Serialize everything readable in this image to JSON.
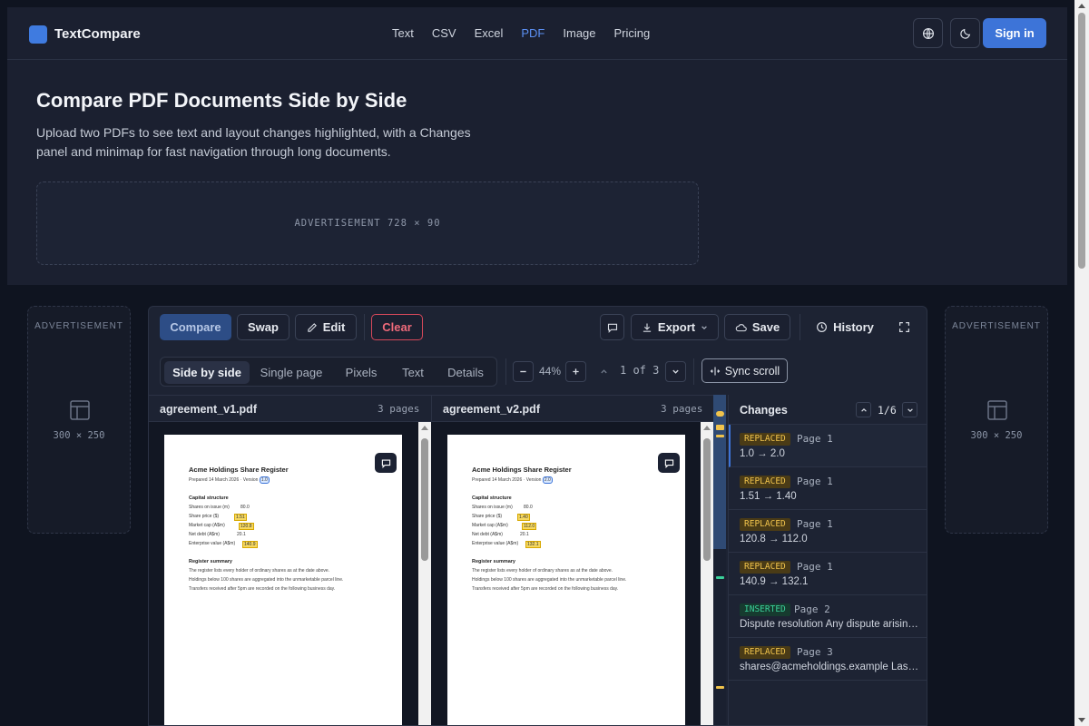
{
  "navbar": {
    "brand": "TextCompare",
    "links": [
      "Text",
      "CSV",
      "Excel",
      "PDF",
      "Image",
      "Pricing"
    ],
    "active_link": "PDF",
    "signin_label": "Sign in"
  },
  "hero": {
    "title": "Compare PDF Documents Side by Side",
    "subtitle": "Upload two PDFs to see text and layout changes highlighted, with a Changes panel and minimap for fast navigation through long documents."
  },
  "ads": {
    "top_label": "ADVERTISEMENT  728 × 90",
    "side_label": "ADVERTISEMENT",
    "side_size": "300 × 250"
  },
  "toolbar": {
    "compare_label": "Compare",
    "swap_label": "Swap",
    "edit_label": "Edit",
    "clear_label": "Clear",
    "export_label": "Export",
    "save_label": "Save",
    "history_label": "History"
  },
  "view_modes": [
    "Side by side",
    "Single page",
    "Pixels",
    "Text",
    "Details"
  ],
  "active_view": "Side by side",
  "zoom": "44%",
  "page_indicator": "1 of 3",
  "sync_label": "Sync scroll",
  "files": {
    "left": {
      "name": "agreement_v1.pdf",
      "pages": "3 pages"
    },
    "right": {
      "name": "agreement_v2.pdf",
      "pages": "3 pages"
    }
  },
  "doc_left": {
    "title": "Acme Holdings   Share Register",
    "prepared": "Prepared 14 March 2026 · Version",
    "version": "1.0",
    "section1": "Capital structure",
    "rows": [
      {
        "label": "Shares on issue (m)",
        "value": "80.0",
        "changed": false
      },
      {
        "label": "Share price ($)",
        "value": "1.51",
        "changed": true
      },
      {
        "label": "Market cap (A$m)",
        "value": "120.8",
        "changed": true
      },
      {
        "label": "Net debt (A$m)",
        "value": "20.1",
        "changed": false
      },
      {
        "label": "Enterprise value (A$m)",
        "value": "140.9",
        "changed": true
      }
    ],
    "section2": "Register summary",
    "lines": [
      "The register lists every holder of ordinary shares as at the date above.",
      "Holdings below 100 shares are aggregated into the unmarketable parcel line.",
      "Transfers received after 5pm are recorded on the following business day."
    ]
  },
  "doc_right": {
    "title": "Acme Holdings   Share Register",
    "prepared": "Prepared 14 March 2026 · Version",
    "version": "2.0",
    "section1": "Capital structure",
    "rows": [
      {
        "label": "Shares on issue (m)",
        "value": "80.0",
        "changed": false
      },
      {
        "label": "Share price ($)",
        "value": "1.40",
        "changed": true
      },
      {
        "label": "Market cap (A$m)",
        "value": "112.0",
        "changed": true
      },
      {
        "label": "Net debt (A$m)",
        "value": "20.1",
        "changed": false
      },
      {
        "label": "Enterprise value (A$m)",
        "value": "132.1",
        "changed": true
      }
    ],
    "section2": "Register summary",
    "lines": [
      "The register lists every holder of ordinary shares as at the date above.",
      "Holdings below 100 shares are aggregated into the unmarketable parcel line.",
      "Transfers received after 5pm are recorded on the following business day."
    ]
  },
  "changes": {
    "title": "Changes",
    "count": "1/6",
    "items": [
      {
        "type": "REPLACED",
        "page": "Page 1",
        "text": "1.0 → 2.0"
      },
      {
        "type": "REPLACED",
        "page": "Page 1",
        "text": "1.51 → 1.40"
      },
      {
        "type": "REPLACED",
        "page": "Page 1",
        "text": "120.8 → 112.0"
      },
      {
        "type": "REPLACED",
        "page": "Page 1",
        "text": "140.9 → 132.1"
      },
      {
        "type": "INSERTED",
        "page": "Page 2",
        "text": "Dispute resolution Any dispute arising under this agreement"
      },
      {
        "type": "REPLACED",
        "page": "Page 3",
        "text": "shares@acmeholdings.example Last updated"
      }
    ]
  },
  "colors": {
    "accent": "#3d74d8",
    "replaced": "#f0c34c",
    "inserted": "#3ad09a",
    "danger": "#ee6a7a"
  }
}
